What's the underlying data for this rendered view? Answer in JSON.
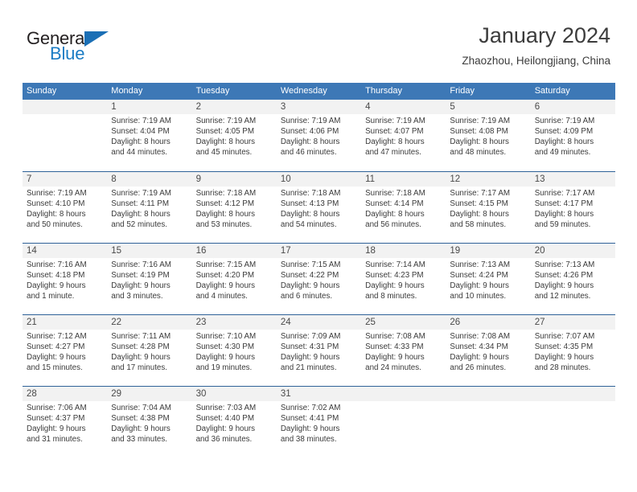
{
  "brand": {
    "name_part1": "General",
    "name_part2": "Blue",
    "triangle_color": "#1b6fb5"
  },
  "header": {
    "title": "January 2024",
    "subtitle": "Zhaozhou, Heilongjiang, China"
  },
  "colors": {
    "header_blue": "#3d78b6",
    "week_divider": "#2f6298",
    "day_band": "#f2f2f2"
  },
  "weekdays": [
    "Sunday",
    "Monday",
    "Tuesday",
    "Wednesday",
    "Thursday",
    "Friday",
    "Saturday"
  ],
  "weeks": [
    [
      {
        "day": "",
        "sunrise": "",
        "sunset": "",
        "daylight1": "",
        "daylight2": ""
      },
      {
        "day": "1",
        "sunrise": "Sunrise: 7:19 AM",
        "sunset": "Sunset: 4:04 PM",
        "daylight1": "Daylight: 8 hours",
        "daylight2": "and 44 minutes."
      },
      {
        "day": "2",
        "sunrise": "Sunrise: 7:19 AM",
        "sunset": "Sunset: 4:05 PM",
        "daylight1": "Daylight: 8 hours",
        "daylight2": "and 45 minutes."
      },
      {
        "day": "3",
        "sunrise": "Sunrise: 7:19 AM",
        "sunset": "Sunset: 4:06 PM",
        "daylight1": "Daylight: 8 hours",
        "daylight2": "and 46 minutes."
      },
      {
        "day": "4",
        "sunrise": "Sunrise: 7:19 AM",
        "sunset": "Sunset: 4:07 PM",
        "daylight1": "Daylight: 8 hours",
        "daylight2": "and 47 minutes."
      },
      {
        "day": "5",
        "sunrise": "Sunrise: 7:19 AM",
        "sunset": "Sunset: 4:08 PM",
        "daylight1": "Daylight: 8 hours",
        "daylight2": "and 48 minutes."
      },
      {
        "day": "6",
        "sunrise": "Sunrise: 7:19 AM",
        "sunset": "Sunset: 4:09 PM",
        "daylight1": "Daylight: 8 hours",
        "daylight2": "and 49 minutes."
      }
    ],
    [
      {
        "day": "7",
        "sunrise": "Sunrise: 7:19 AM",
        "sunset": "Sunset: 4:10 PM",
        "daylight1": "Daylight: 8 hours",
        "daylight2": "and 50 minutes."
      },
      {
        "day": "8",
        "sunrise": "Sunrise: 7:19 AM",
        "sunset": "Sunset: 4:11 PM",
        "daylight1": "Daylight: 8 hours",
        "daylight2": "and 52 minutes."
      },
      {
        "day": "9",
        "sunrise": "Sunrise: 7:18 AM",
        "sunset": "Sunset: 4:12 PM",
        "daylight1": "Daylight: 8 hours",
        "daylight2": "and 53 minutes."
      },
      {
        "day": "10",
        "sunrise": "Sunrise: 7:18 AM",
        "sunset": "Sunset: 4:13 PM",
        "daylight1": "Daylight: 8 hours",
        "daylight2": "and 54 minutes."
      },
      {
        "day": "11",
        "sunrise": "Sunrise: 7:18 AM",
        "sunset": "Sunset: 4:14 PM",
        "daylight1": "Daylight: 8 hours",
        "daylight2": "and 56 minutes."
      },
      {
        "day": "12",
        "sunrise": "Sunrise: 7:17 AM",
        "sunset": "Sunset: 4:15 PM",
        "daylight1": "Daylight: 8 hours",
        "daylight2": "and 58 minutes."
      },
      {
        "day": "13",
        "sunrise": "Sunrise: 7:17 AM",
        "sunset": "Sunset: 4:17 PM",
        "daylight1": "Daylight: 8 hours",
        "daylight2": "and 59 minutes."
      }
    ],
    [
      {
        "day": "14",
        "sunrise": "Sunrise: 7:16 AM",
        "sunset": "Sunset: 4:18 PM",
        "daylight1": "Daylight: 9 hours",
        "daylight2": "and 1 minute."
      },
      {
        "day": "15",
        "sunrise": "Sunrise: 7:16 AM",
        "sunset": "Sunset: 4:19 PM",
        "daylight1": "Daylight: 9 hours",
        "daylight2": "and 3 minutes."
      },
      {
        "day": "16",
        "sunrise": "Sunrise: 7:15 AM",
        "sunset": "Sunset: 4:20 PM",
        "daylight1": "Daylight: 9 hours",
        "daylight2": "and 4 minutes."
      },
      {
        "day": "17",
        "sunrise": "Sunrise: 7:15 AM",
        "sunset": "Sunset: 4:22 PM",
        "daylight1": "Daylight: 9 hours",
        "daylight2": "and 6 minutes."
      },
      {
        "day": "18",
        "sunrise": "Sunrise: 7:14 AM",
        "sunset": "Sunset: 4:23 PM",
        "daylight1": "Daylight: 9 hours",
        "daylight2": "and 8 minutes."
      },
      {
        "day": "19",
        "sunrise": "Sunrise: 7:13 AM",
        "sunset": "Sunset: 4:24 PM",
        "daylight1": "Daylight: 9 hours",
        "daylight2": "and 10 minutes."
      },
      {
        "day": "20",
        "sunrise": "Sunrise: 7:13 AM",
        "sunset": "Sunset: 4:26 PM",
        "daylight1": "Daylight: 9 hours",
        "daylight2": "and 12 minutes."
      }
    ],
    [
      {
        "day": "21",
        "sunrise": "Sunrise: 7:12 AM",
        "sunset": "Sunset: 4:27 PM",
        "daylight1": "Daylight: 9 hours",
        "daylight2": "and 15 minutes."
      },
      {
        "day": "22",
        "sunrise": "Sunrise: 7:11 AM",
        "sunset": "Sunset: 4:28 PM",
        "daylight1": "Daylight: 9 hours",
        "daylight2": "and 17 minutes."
      },
      {
        "day": "23",
        "sunrise": "Sunrise: 7:10 AM",
        "sunset": "Sunset: 4:30 PM",
        "daylight1": "Daylight: 9 hours",
        "daylight2": "and 19 minutes."
      },
      {
        "day": "24",
        "sunrise": "Sunrise: 7:09 AM",
        "sunset": "Sunset: 4:31 PM",
        "daylight1": "Daylight: 9 hours",
        "daylight2": "and 21 minutes."
      },
      {
        "day": "25",
        "sunrise": "Sunrise: 7:08 AM",
        "sunset": "Sunset: 4:33 PM",
        "daylight1": "Daylight: 9 hours",
        "daylight2": "and 24 minutes."
      },
      {
        "day": "26",
        "sunrise": "Sunrise: 7:08 AM",
        "sunset": "Sunset: 4:34 PM",
        "daylight1": "Daylight: 9 hours",
        "daylight2": "and 26 minutes."
      },
      {
        "day": "27",
        "sunrise": "Sunrise: 7:07 AM",
        "sunset": "Sunset: 4:35 PM",
        "daylight1": "Daylight: 9 hours",
        "daylight2": "and 28 minutes."
      }
    ],
    [
      {
        "day": "28",
        "sunrise": "Sunrise: 7:06 AM",
        "sunset": "Sunset: 4:37 PM",
        "daylight1": "Daylight: 9 hours",
        "daylight2": "and 31 minutes."
      },
      {
        "day": "29",
        "sunrise": "Sunrise: 7:04 AM",
        "sunset": "Sunset: 4:38 PM",
        "daylight1": "Daylight: 9 hours",
        "daylight2": "and 33 minutes."
      },
      {
        "day": "30",
        "sunrise": "Sunrise: 7:03 AM",
        "sunset": "Sunset: 4:40 PM",
        "daylight1": "Daylight: 9 hours",
        "daylight2": "and 36 minutes."
      },
      {
        "day": "31",
        "sunrise": "Sunrise: 7:02 AM",
        "sunset": "Sunset: 4:41 PM",
        "daylight1": "Daylight: 9 hours",
        "daylight2": "and 38 minutes."
      },
      {
        "day": "",
        "sunrise": "",
        "sunset": "",
        "daylight1": "",
        "daylight2": ""
      },
      {
        "day": "",
        "sunrise": "",
        "sunset": "",
        "daylight1": "",
        "daylight2": ""
      },
      {
        "day": "",
        "sunrise": "",
        "sunset": "",
        "daylight1": "",
        "daylight2": ""
      }
    ]
  ]
}
